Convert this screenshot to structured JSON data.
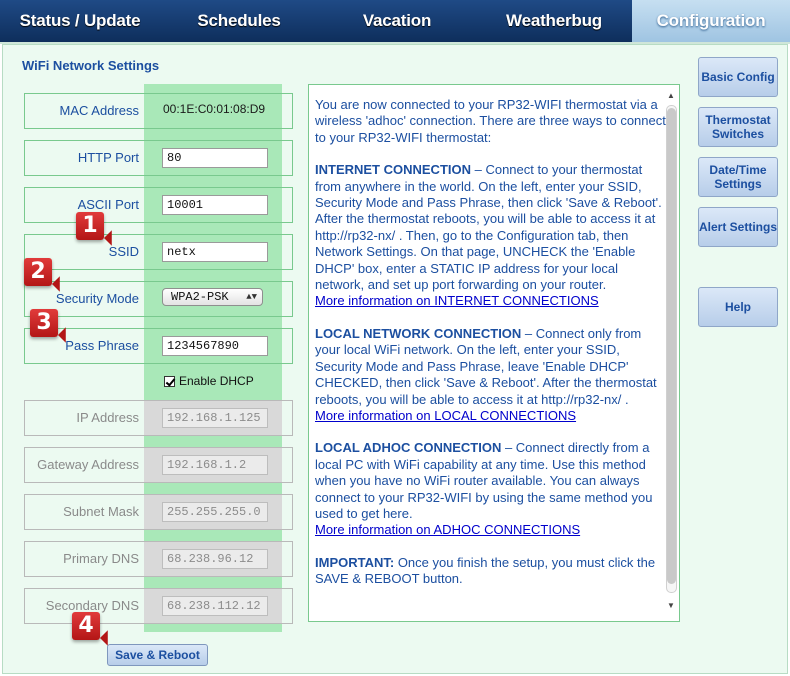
{
  "nav": {
    "tabs": [
      {
        "label": "Status / Update"
      },
      {
        "label": "Schedules"
      },
      {
        "label": "Vacation"
      },
      {
        "label": "Weatherbug"
      },
      {
        "label": "Configuration"
      }
    ],
    "active": "Configuration"
  },
  "section": {
    "title": "WiFi Network Settings"
  },
  "network": {
    "mac_label": "MAC Address",
    "mac_value": "00:1E:C0:01:08:D9",
    "http_port_label": "HTTP Port",
    "http_port_value": "80",
    "ascii_port_label": "ASCII Port",
    "ascii_port_value": "10001",
    "ssid_label": "SSID",
    "ssid_value": "netx",
    "security_label": "Security Mode",
    "security_value": "WPA2-PSK",
    "pass_label": "Pass Phrase",
    "pass_value": "1234567890",
    "dhcp_label": "Enable DHCP",
    "ip_label": "IP Address",
    "ip_value": "192.168.1.125",
    "gateway_label": "Gateway Address",
    "gateway_value": "192.168.1.2",
    "subnet_label": "Subnet Mask",
    "subnet_value": "255.255.255.0",
    "dns1_label": "Primary DNS",
    "dns1_value": "68.238.96.12",
    "dns2_label": "Secondary DNS",
    "dns2_value": "68.238.112.12"
  },
  "info": {
    "intro": "You are now connected to your RP32-WIFI thermostat via a wireless 'adhoc' connection. There are three ways to connect to your RP32-WIFI thermostat:",
    "internet_heading": "INTERNET CONNECTION",
    "internet_body": " – Connect to your thermostat from anywhere in the world. On the left, enter your SSID, Security Mode and Pass Phrase, then click 'Save & Reboot'. After the thermostat reboots, you will be able to access it at http://rp32-nx/ . Then, go to the Configuration tab, then Network Settings. On that page, UNCHECK the 'Enable DHCP' box, enter a STATIC IP address for your local network, and set up port forwarding on your router.",
    "internet_link": "More information on INTERNET CONNECTIONS",
    "local_heading": "LOCAL NETWORK CONNECTION",
    "local_body": " – Connect only from your local WiFi network.  On the left, enter your SSID, Security Mode and Pass Phrase, leave 'Enable DHCP' CHECKED, then click 'Save & Reboot'. After the thermostat reboots, you will be able to access it at http://rp32-nx/ .",
    "local_link": "More information on LOCAL CONNECTIONS",
    "adhoc_heading": "LOCAL ADHOC CONNECTION",
    "adhoc_body": " – Connect directly from a local PC with WiFi capability at any time.  Use this method when you have no WiFi router available. You can always connect to your RP32-WIFI by using the same method you used to get here.",
    "adhoc_link": "More information on ADHOC CONNECTIONS",
    "important_heading": "IMPORTANT:",
    "important_body": " Once you finish the setup, you must click the SAVE & REBOOT button."
  },
  "side_buttons": {
    "basic": "Basic Config",
    "thermostat": "Thermostat Switches",
    "datetime": "Date/Time Settings",
    "alert": "Alert Settings",
    "help": "Help"
  },
  "save_button": "Save & Reboot",
  "badges": [
    "1",
    "2",
    "3",
    "4"
  ],
  "colors": {
    "nav_bg": "#0e2e5c",
    "active_tab": "#b6d4ee",
    "panel_bg": "#ecfaf1",
    "green_column": "#a9e8b8",
    "label_text": "#1c4fa0",
    "badge_red": "#c92020"
  }
}
